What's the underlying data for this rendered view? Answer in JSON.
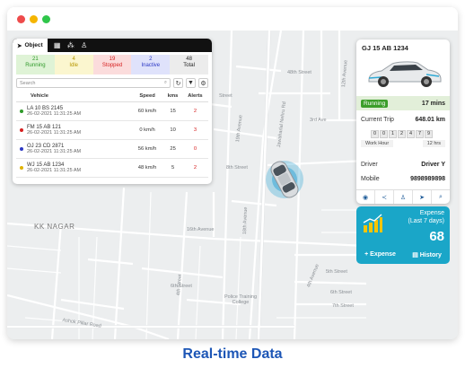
{
  "object_panel": {
    "active_tab": "Object",
    "stats": [
      {
        "count": "21",
        "label": "Running"
      },
      {
        "count": "4",
        "label": "Idle"
      },
      {
        "count": "19",
        "label": "Stopped"
      },
      {
        "count": "2",
        "label": "Inactive"
      },
      {
        "count": "48",
        "label": "Total"
      }
    ],
    "search_placeholder": "Search",
    "columns": [
      "Vehicle",
      "Speed",
      "kms",
      "Alerts"
    ],
    "rows": [
      {
        "plate": "LA 10 BS 2145",
        "datetime": "26-02-2021 11:31:25 AM",
        "speed": "60 km/h",
        "kms": "15",
        "alerts": "2",
        "status_color": "#2f9a2a"
      },
      {
        "plate": "FM 15 AB 121",
        "datetime": "26-02-2021 11:31:25 AM",
        "speed": "0 km/h",
        "kms": "10",
        "alerts": "3",
        "status_color": "#d62020"
      },
      {
        "plate": "OJ 23 CD 2871",
        "datetime": "26-02-2021 11:31:25 AM",
        "speed": "56 km/h",
        "kms": "25",
        "alerts": "0",
        "status_color": "#2d39c4"
      },
      {
        "plate": "WJ 15 AB 1234",
        "datetime": "26-02-2021 11:31:25 AM",
        "speed": "48 km/h",
        "kms": "5",
        "alerts": "2",
        "status_color": "#e0b300"
      }
    ]
  },
  "map_labels": {
    "street_top": "Street",
    "third_ave": "3rd Ave",
    "eighth_st": "8th Street",
    "jawaharlal": "Jawaharlal Nehru Rd",
    "nineteenth": "19th Avenue",
    "eighteenth": "18th Avenue",
    "kk_nagar": "KK NAGAR",
    "sixteenth": "16th Avenue",
    "fourth_ave": "4th Avenue",
    "fifth_st": "5th Street",
    "sixth_st": "6th Street",
    "seventh_st": "7th Street",
    "sixth_ave": "6th Street",
    "fourth_st": "4th Street",
    "police": "Police Training College",
    "ashok": "Ashok Pillar Road",
    "twelve": "12th Avenue",
    "fortyeight": "48th Street"
  },
  "vehicle_card": {
    "plate": "GJ 15 AB 1234",
    "status": "Running",
    "duration": "17 mins",
    "trip_label": "Current Trip",
    "trip_value": "648.01 km",
    "odometer": [
      "0",
      "0",
      "1",
      "2",
      "4",
      "7",
      "9"
    ],
    "work_label": "Work Hour",
    "work_value": "12 hrs",
    "driver_label": "Driver",
    "driver_value": "Driver Y",
    "mobile_label": "Mobile",
    "mobile_value": "9898989898"
  },
  "expense_card": {
    "label_line1": "Expense",
    "label_line2": "(Last 7 days)",
    "value": "68",
    "add_label": "Expense",
    "history_label": "History"
  },
  "caption": "Real-time Data"
}
